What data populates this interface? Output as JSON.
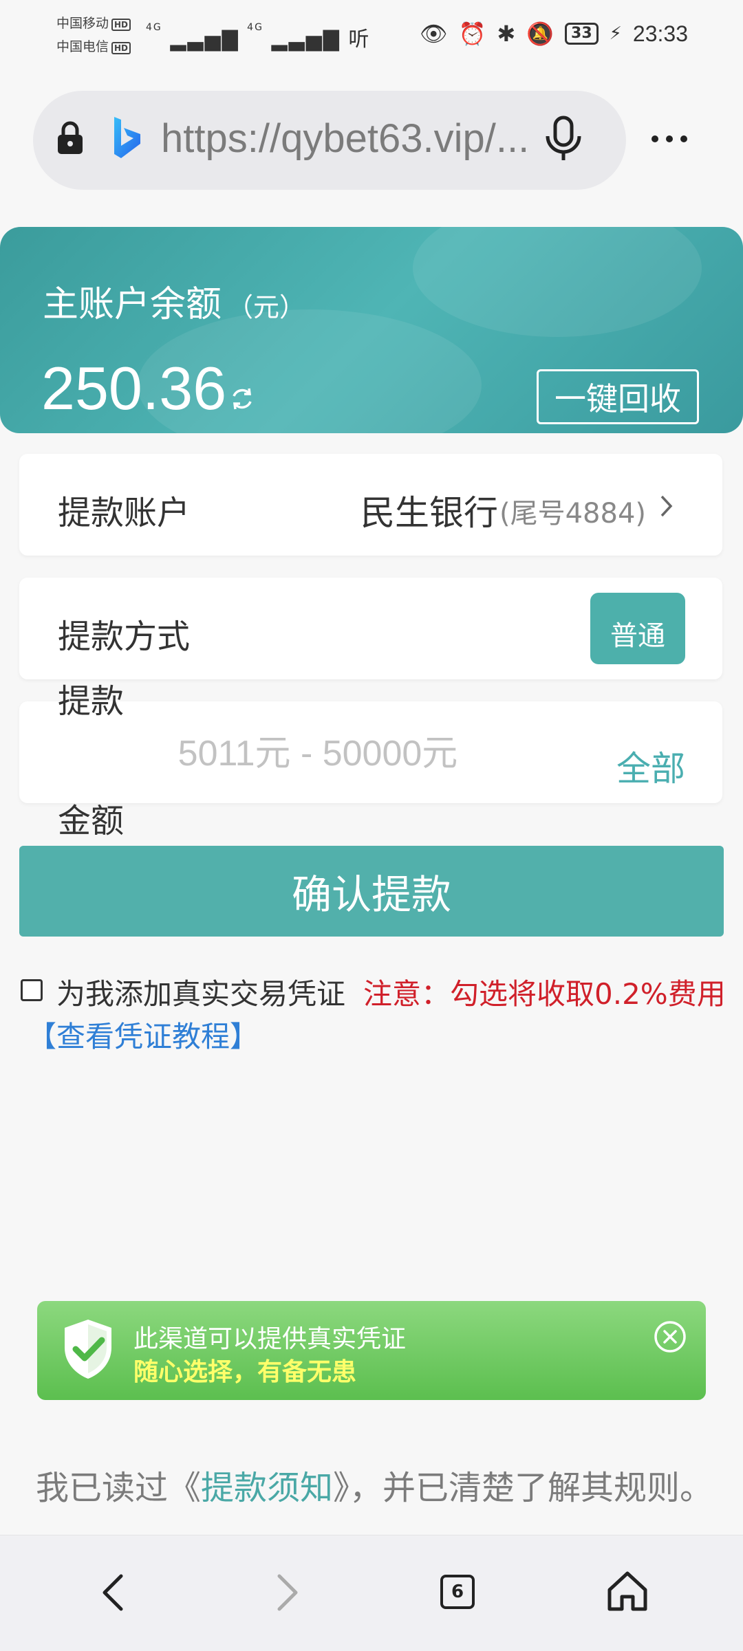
{
  "status_bar": {
    "carrier1": "中国移动",
    "carrier2": "中国电信",
    "hd": "HD",
    "net1": "4G",
    "net2": "4G",
    "audio": "听",
    "battery": "33",
    "time": "23:33"
  },
  "browser": {
    "url": "https://qybet63.vip/..."
  },
  "balance": {
    "label": "主账户余额",
    "unit": "（元）",
    "amount": "250.36",
    "recycle_label": "一键回收"
  },
  "withdraw_account": {
    "label": "提款账户",
    "bank": "民生银行",
    "tail": "(尾号4884)"
  },
  "withdraw_method": {
    "label": "提款方式",
    "option": "普通"
  },
  "withdraw_amount": {
    "label_top": "提款",
    "label_bottom": "金额",
    "placeholder": "5011元 - 50000元",
    "all_label": "全部"
  },
  "confirm_label": "确认提款",
  "voucher": {
    "label": "为我添加真实交易凭证",
    "note": "注意：勾选将收取0.2%费用",
    "tutorial": "【查看凭证教程】"
  },
  "toast": {
    "line1": "此渠道可以提供真实凭证",
    "line2": "随心选择，有备无患"
  },
  "agreement": {
    "prefix": "我已读过《",
    "link": "提款须知",
    "suffix": "》，并已清楚了解其规则。"
  },
  "nav": {
    "tab_count": "6"
  },
  "colors": {
    "accent": "#52b0ab",
    "warning": "#d0202a",
    "link": "#2f7fd6",
    "toast": "#6cc65f"
  }
}
